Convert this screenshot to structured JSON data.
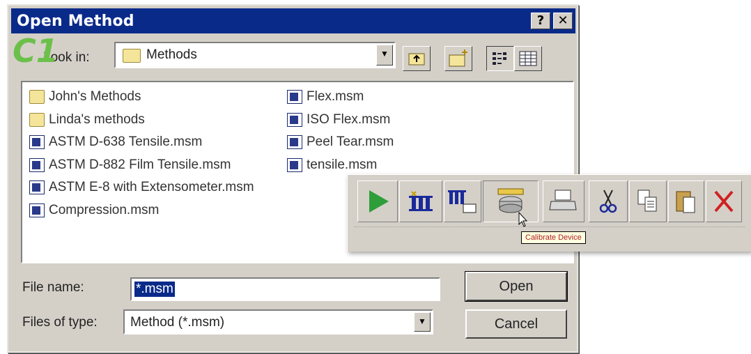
{
  "dialog": {
    "title": "Open Method",
    "help_label": "?",
    "close_label": "✕"
  },
  "look_in": {
    "label": "Look in:",
    "value": "Methods",
    "dropdown_arrow": "▼"
  },
  "toolbar": {
    "icons": [
      "up-folder-icon",
      "new-folder-icon",
      "list-view-icon",
      "details-view-icon"
    ]
  },
  "files": {
    "col1": [
      {
        "name": "John's Methods",
        "type": "folder"
      },
      {
        "name": "Linda's methods",
        "type": "folder"
      },
      {
        "name": "ASTM D-638 Tensile.msm",
        "type": "msm"
      },
      {
        "name": "ASTM D-882 Film Tensile.msm",
        "type": "msm"
      },
      {
        "name": "ASTM E-8 with Extensometer.msm",
        "type": "msm"
      },
      {
        "name": "Compression.msm",
        "type": "msm"
      }
    ],
    "col2": [
      {
        "name": "Flex.msm",
        "type": "msm"
      },
      {
        "name": "ISO Flex.msm",
        "type": "msm"
      },
      {
        "name": "Peel Tear.msm",
        "type": "msm"
      },
      {
        "name": "tensile.msm",
        "type": "msm"
      }
    ]
  },
  "file_name": {
    "label": "File name:",
    "value": "*.msm"
  },
  "file_type": {
    "label": "Files of type:",
    "value": "Method (*.msm)",
    "dropdown_arrow": "▼"
  },
  "buttons": {
    "open": "Open",
    "cancel": "Cancel"
  },
  "overlay": {
    "badge": "C1",
    "tooltip": "Calibrate Device",
    "toolbar_icons": [
      "run-icon",
      "new-specimen-icon",
      "specimen-list-icon",
      "calibrate-device-icon",
      "print-icon",
      "cut-icon",
      "copy-icon",
      "paste-icon",
      "delete-icon"
    ],
    "colors": {
      "run": "#2e9e3a",
      "delete": "#d02020",
      "specimen": "#1a2a9a"
    }
  }
}
